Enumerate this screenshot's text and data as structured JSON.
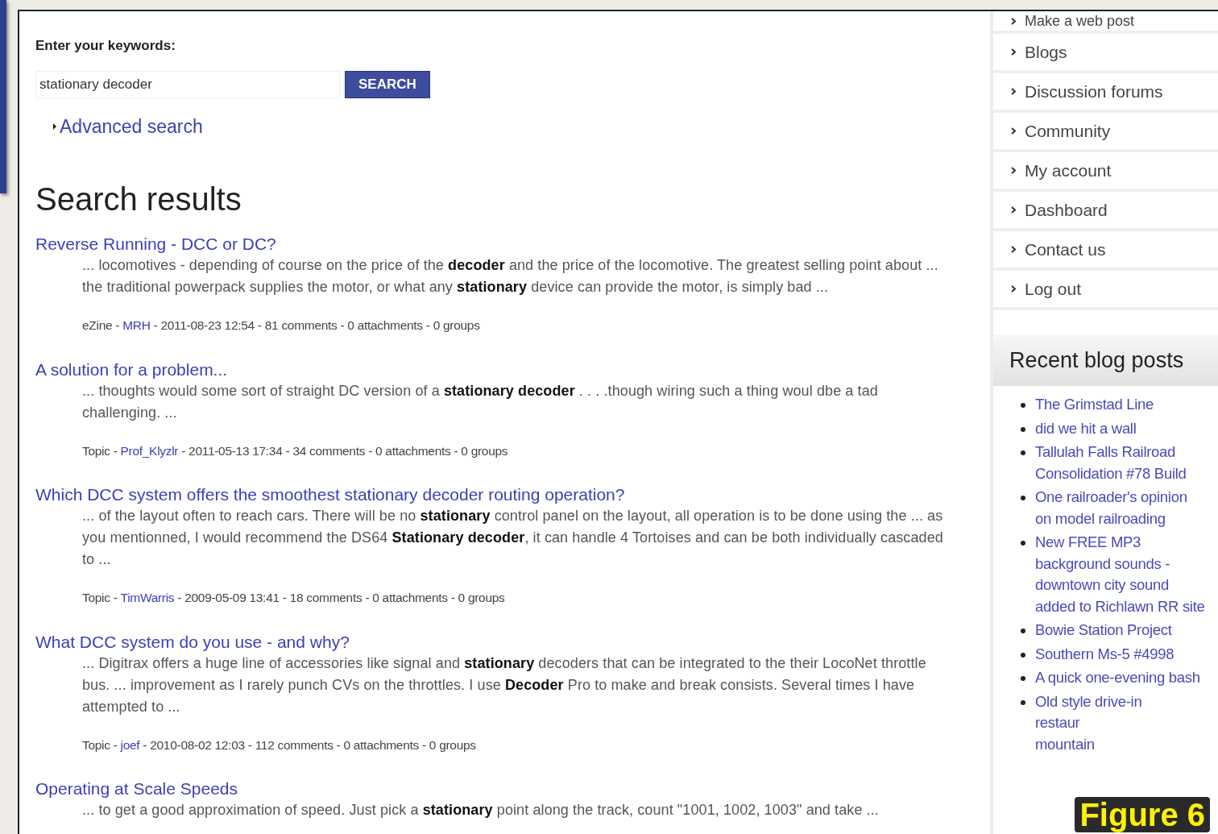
{
  "search_form": {
    "label": "Enter your keywords:",
    "value": "stationary decoder",
    "button": "SEARCH",
    "advanced_link": "Advanced search"
  },
  "heading": "Search results",
  "results": [
    {
      "title": "Reverse Running - DCC or DC?",
      "snippet": "... locomotives - depending of course on the price of the **decoder** and the price of the locomotive. The greatest selling point about ... the traditional powerpack supplies the motor, or what any **stationary** device can provide the motor, is simply bad ...",
      "meta_before": "eZine - ",
      "author": "MRH",
      "meta_after": " - 2011-08-23 12:54 - 81 comments - 0 attachments - 0 groups"
    },
    {
      "title": "A solution for a problem...",
      "snippet": "... thoughts would some sort of straight DC version of a **stationary decoder** . . . .though wiring such a thing woul dbe a tad challenging. ...",
      "meta_before": "Topic - ",
      "author": "Prof_Klyzlr",
      "meta_after": " - 2011-05-13 17:34 - 34 comments - 0 attachments - 0 groups"
    },
    {
      "title": "Which DCC system offers the smoothest stationary decoder routing operation?",
      "snippet": "... of the layout often to reach cars.  There will be no **stationary** control panel on the layout, all operation is to be done using the ... as you mentionned, I would recommend the DS64 **Stationary decoder**, it can handle 4 Tortoises and can be both individually cascaded to ...",
      "meta_before": "Topic - ",
      "author": "TimWarris",
      "meta_after": " - 2009-05-09 13:41 - 18 comments - 0 attachments - 0 groups"
    },
    {
      "title": "What DCC system do you use - and why?",
      "snippet": "... Digitrax offers a huge line of accessories like signal and **stationary** decoders that can be integrated to the their LocoNet throttle bus. ... improvement as I rarely punch CVs on the throttles. I use **Decoder** Pro to make and break consists. Several times I have attempted to ...",
      "meta_before": "Topic - ",
      "author": "joef",
      "meta_after": " - 2010-08-02 12:03 - 112 comments - 0 attachments - 0 groups"
    },
    {
      "title": "Operating at Scale Speeds",
      "snippet": "... to get a good approximation of speed. Just pick a **stationary** point along the track, count \"1001, 1002, 1003\" and take ..."
    }
  ],
  "sidebar": {
    "nav": [
      "Make a web post",
      "Blogs",
      "Discussion forums",
      "Community",
      "My account",
      "Dashboard",
      "Contact us",
      "Log out"
    ],
    "recent_title": "Recent blog posts",
    "recent_posts": [
      {
        "lines": [
          "The Grimstad Line"
        ]
      },
      {
        "lines": [
          "did we hit a wall"
        ]
      },
      {
        "lines": [
          "Tallulah Falls Railroad Consolidation #78 Build"
        ]
      },
      {
        "lines": [
          "One railroader's opinion on model railroading"
        ]
      },
      {
        "lines": [
          "New FREE MP3 background sounds - downtown city sound added to Richlawn RR site"
        ]
      },
      {
        "lines": [
          "Bowie Station Project"
        ]
      },
      {
        "lines": [
          "Southern Ms-5 #4998"
        ]
      },
      {
        "lines": [
          "A quick one-evening bash"
        ]
      },
      {
        "lines": [
          "Old style drive-in",
          "restaur",
          "mountain"
        ]
      }
    ]
  },
  "caption": "Figure 6"
}
